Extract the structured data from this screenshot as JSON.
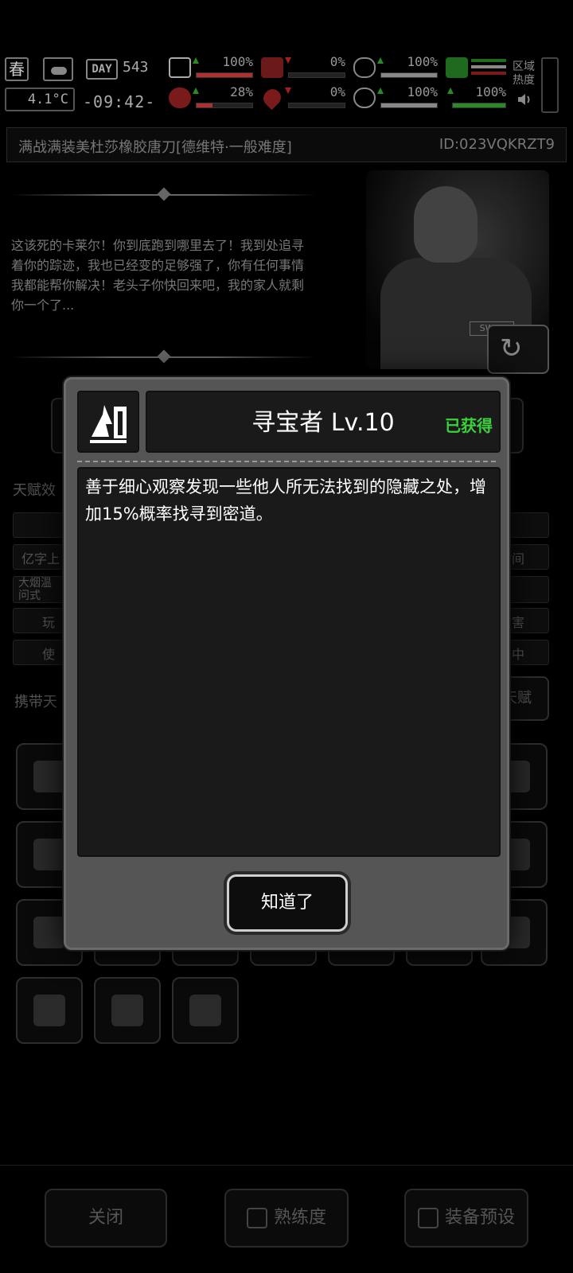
{
  "hud": {
    "season": "春",
    "temperature": "4.1°C",
    "day_label": "DAY",
    "day_number": "543",
    "clock": "-09:42-",
    "stats": [
      {
        "name": "health",
        "value": "100%",
        "trend": "up",
        "color": "#b03030",
        "fill": 1.0
      },
      {
        "name": "stomach",
        "value": "0%",
        "trend": "down",
        "color": "#b03030",
        "fill": 0.0
      },
      {
        "name": "armor",
        "value": "100%",
        "trend": "up",
        "color": "#888888",
        "fill": 1.0
      },
      {
        "name": "food",
        "value": "28%",
        "trend": "up",
        "color": "#b03030",
        "fill": 0.28
      },
      {
        "name": "blood",
        "value": "0%",
        "trend": "down",
        "color": "#b03030",
        "fill": 0.0
      },
      {
        "name": "mood",
        "value": "100%",
        "trend": "up",
        "color": "#888888",
        "fill": 1.0
      },
      {
        "name": "stamina",
        "value": "100%",
        "trend": "up",
        "color": "#2a8a2a",
        "fill": 1.0
      }
    ],
    "zone_label": "区域热度"
  },
  "title_bar": {
    "title": "满战满装美杜莎橡胶唐刀[德维特·一般难度]",
    "id": "ID:023VQKRZT9"
  },
  "story_text": "这该死的卡莱尔！你到底跑到哪里去了！我到处追寻着你的踪迹，我也已经变的足够强了，你有任何事情我都能帮你解决！老头子你快回来吧，我的家人就剩你一个了...",
  "portrait_badge": "SWAT",
  "background": {
    "talent_effect_label": "天赋效",
    "rows": [
      {
        "left": "",
        "right": ""
      },
      {
        "left": "亿字上",
        "right": "时间"
      },
      {
        "left": "大烟温 问式",
        "right": ""
      },
      {
        "left": "玩",
        "right": "伤害"
      },
      {
        "left": "使",
        "right": "中"
      }
    ],
    "carry_label": "携带天",
    "talent_button": "天赋"
  },
  "bottom_buttons": {
    "close": "关闭",
    "proficiency": "熟练度",
    "preset": "装备预设"
  },
  "modal": {
    "title": "寻宝者 Lv.10",
    "status": "已获得",
    "description": "善于细心观察发现一些他人所无法找到的隐藏之处，增加15%概率找寻到密道。",
    "ok_button": "知道了"
  },
  "colors": {
    "acquired_green": "#3bd13b",
    "modal_frame": "#555555",
    "panel_dark": "#1a1a1a"
  }
}
